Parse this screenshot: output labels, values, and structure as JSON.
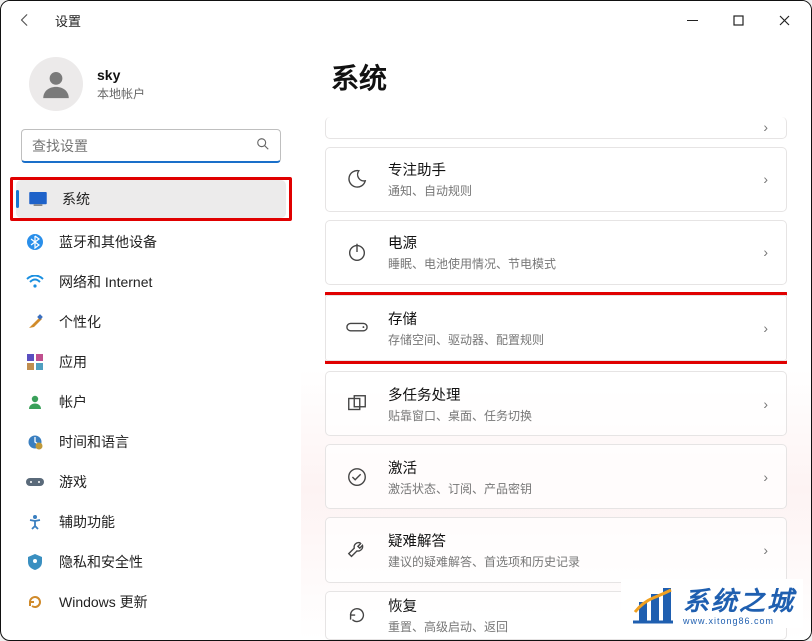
{
  "window": {
    "title": "设置"
  },
  "user": {
    "name": "sky",
    "type": "本地帐户"
  },
  "search": {
    "placeholder": "查找设置"
  },
  "nav": {
    "items": [
      {
        "id": "system",
        "label": "系统",
        "active": true
      },
      {
        "id": "bluetooth",
        "label": "蓝牙和其他设备"
      },
      {
        "id": "network",
        "label": "网络和 Internet"
      },
      {
        "id": "personalization",
        "label": "个性化"
      },
      {
        "id": "apps",
        "label": "应用"
      },
      {
        "id": "accounts",
        "label": "帐户"
      },
      {
        "id": "time-language",
        "label": "时间和语言"
      },
      {
        "id": "gaming",
        "label": "游戏"
      },
      {
        "id": "accessibility",
        "label": "辅助功能"
      },
      {
        "id": "privacy",
        "label": "隐私和安全性"
      },
      {
        "id": "windows-update",
        "label": "Windows 更新"
      }
    ]
  },
  "page": {
    "title": "系统"
  },
  "cards": [
    {
      "id": "focus",
      "title": "专注助手",
      "sub": "通知、自动规则"
    },
    {
      "id": "power",
      "title": "电源",
      "sub": "睡眠、电池使用情况、节电模式"
    },
    {
      "id": "storage",
      "title": "存储",
      "sub": "存储空间、驱动器、配置规则",
      "highlighted": true
    },
    {
      "id": "multitasking",
      "title": "多任务处理",
      "sub": "贴靠窗口、桌面、任务切换"
    },
    {
      "id": "activation",
      "title": "激活",
      "sub": "激活状态、订阅、产品密钥"
    },
    {
      "id": "troubleshoot",
      "title": "疑难解答",
      "sub": "建议的疑难解答、首选项和历史记录"
    },
    {
      "id": "recovery",
      "title": "恢复",
      "sub": "重置、高级启动、返回"
    }
  ],
  "watermark": {
    "text": "系统之城",
    "sub": "www.xitong86.com"
  }
}
